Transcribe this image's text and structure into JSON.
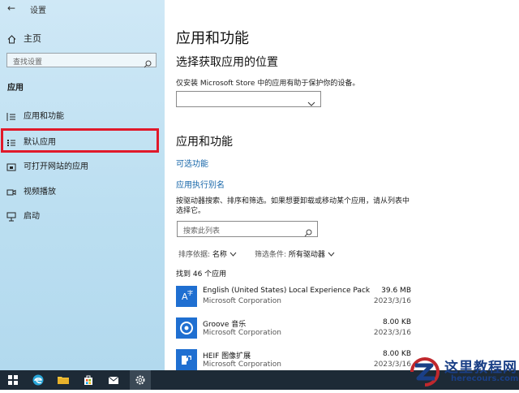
{
  "window": {
    "title": "设置",
    "back_glyph": "←"
  },
  "sidebar": {
    "home_label": "主页",
    "search_placeholder": "查找设置",
    "section_title": "应用",
    "items": [
      {
        "label": "应用和功能",
        "icon": "apps-list-icon"
      },
      {
        "label": "默认应用",
        "icon": "default-apps-icon",
        "highlighted": true
      },
      {
        "label": "可打开网站的应用",
        "icon": "web-apps-icon"
      },
      {
        "label": "视频播放",
        "icon": "video-icon"
      },
      {
        "label": "启动",
        "icon": "startup-icon"
      }
    ]
  },
  "main": {
    "title": "应用和功能",
    "location_heading": "选择获取应用的位置",
    "location_desc": "仅安装 Microsoft Store 中的应用有助于保护你的设备。",
    "location_value": "",
    "apps_heading": "应用和功能",
    "optional_features_link": "可选功能",
    "alias_link": "应用执行别名",
    "search_desc": "按驱动器搜索、排序和筛选。如果想要卸载或移动某个应用，请从列表中选择它。",
    "search_placeholder": "搜索此列表",
    "sort_label": "排序依据:",
    "sort_value": "名称",
    "filter_label": "筛选条件:",
    "filter_value": "所有驱动器",
    "found_text": "找到 46 个应用",
    "apps": [
      {
        "name": "English (United States) Local Experience Pack",
        "publisher": "Microsoft Corporation",
        "size": "39.6 MB",
        "date": "2023/3/16",
        "icon": "language-pack-icon"
      },
      {
        "name": "Groove 音乐",
        "publisher": "Microsoft Corporation",
        "size": "8.00 KB",
        "date": "2023/3/16",
        "icon": "groove-music-icon"
      },
      {
        "name": "HEIF 图像扩展",
        "publisher": "Microsoft Corporation",
        "size": "8.00 KB",
        "date": "2023/3/16",
        "icon": "heif-extension-icon"
      }
    ]
  },
  "taskbar": {
    "items": [
      "windows-start-icon",
      "edge-icon",
      "file-explorer-icon",
      "store-icon",
      "mail-icon",
      "settings-icon"
    ]
  },
  "watermark": {
    "title": "这里教程网",
    "subtitle": "herecours.com"
  },
  "colors": {
    "accent": "#1f6fd1",
    "highlight_border": "#e0192a",
    "link": "#1565a8",
    "sidebar_bg": "#bcdff1",
    "taskbar_bg": "#1d2a36"
  }
}
